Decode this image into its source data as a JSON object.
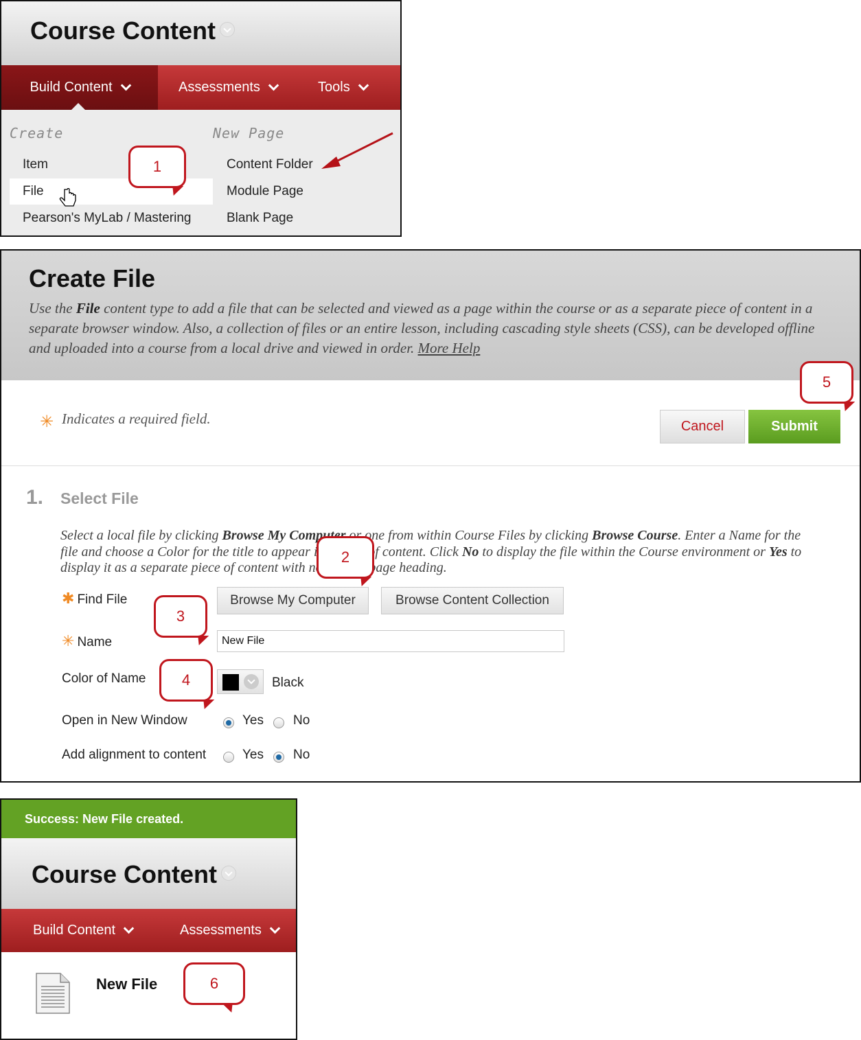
{
  "panel1": {
    "title": "Course Content",
    "nav": [
      "Build Content",
      "Assessments",
      "Tools"
    ],
    "create_label": "Create",
    "new_page_label": "New Page",
    "create_items": [
      "Item",
      "File",
      "Pearson's MyLab / Mastering"
    ],
    "new_page_items": [
      "Content Folder",
      "Module Page",
      "Blank Page"
    ],
    "callout": "1"
  },
  "panel2": {
    "title": "Create File",
    "desc_prefix": "Use the ",
    "desc_bold": "File",
    "desc_text": " content type to add a file that can be selected and viewed as a page within the course or as a separate piece of content in a separate browser window. Also, a collection of files or an entire lesson, including cascading style sheets (CSS), can be developed offline and uploaded into a course from a local drive and viewed in order. ",
    "more_help": "More Help",
    "required_note": "Indicates a required field.",
    "cancel": "Cancel",
    "submit": "Submit",
    "step_number": "1.",
    "step_title": "Select File",
    "step_desc": {
      "t1": "Select a local file by clicking ",
      "b1": "Browse My Computer",
      "t2": " or one from within Course Files by clicking ",
      "b2": "Browse Course",
      "t3": ". Enter a Name for the file and choose a Color for the title to appear in the list of content. Click ",
      "b3": "No",
      "t4": " to display the file within the Course environment or ",
      "b4": "Yes",
      "t5": " to display it as a separate piece of content with no Course page heading."
    },
    "find_file_label": "Find File",
    "browse_my_computer": "Browse My Computer",
    "browse_content_collection": "Browse Content Collection",
    "name_label": "Name",
    "name_value": "New File",
    "color_label": "Color of Name",
    "color_value": "Black",
    "open_new_window_label": "Open in New Window",
    "alignment_label": "Add alignment to content",
    "yes": "Yes",
    "no": "No",
    "callouts": [
      "2",
      "3",
      "4",
      "5"
    ]
  },
  "panel3": {
    "success": "Success: New File created.",
    "title": "Course Content",
    "nav": [
      "Build Content",
      "Assessments"
    ],
    "file_name": "New File",
    "callout": "6"
  },
  "colors": {
    "nav_red": "#b02a2b",
    "callout_red": "#c0161d",
    "submit_green": "#6aaa2a",
    "success_green": "#63a224",
    "required_orange": "#f08a24"
  }
}
